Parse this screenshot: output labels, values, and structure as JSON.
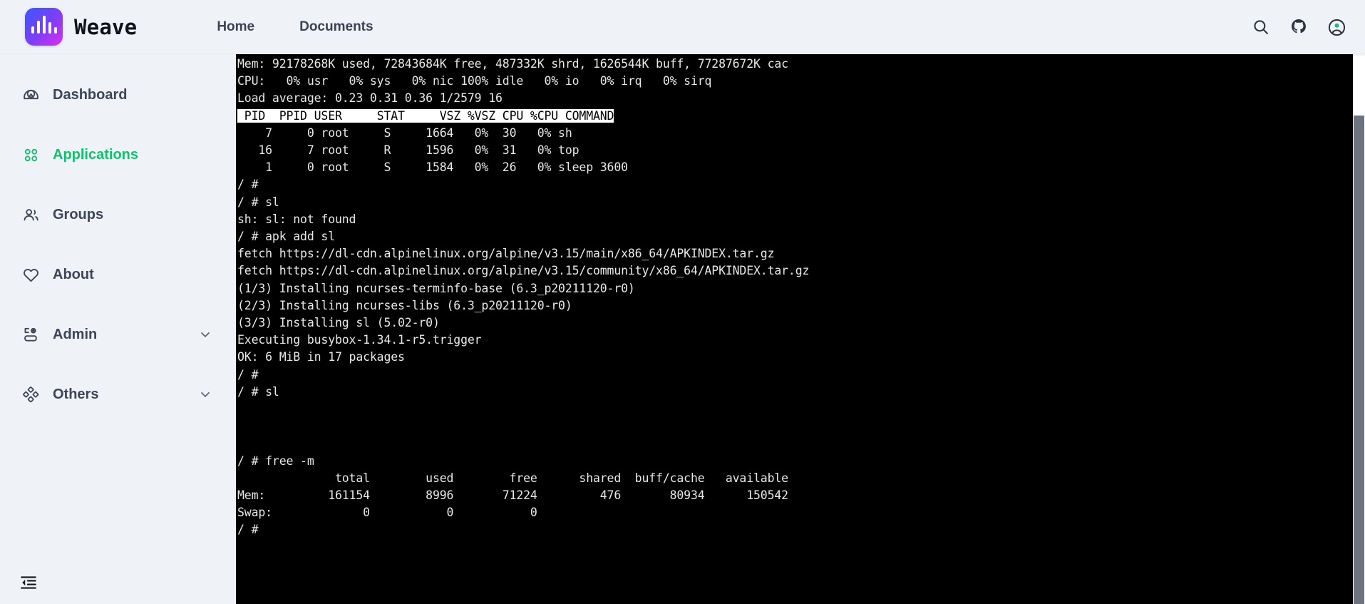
{
  "header": {
    "brand_name": "Weave",
    "logo_icon": "waveform-logo-icon",
    "nav": [
      {
        "label": "Home",
        "name": "nav-link-home"
      },
      {
        "label": "Documents",
        "name": "nav-link-documents"
      }
    ],
    "actions": [
      {
        "name": "search-icon",
        "label": "Search"
      },
      {
        "name": "github-icon",
        "label": "GitHub"
      },
      {
        "name": "account-icon",
        "label": "Account"
      }
    ]
  },
  "sidebar": {
    "items": [
      {
        "label": "Dashboard",
        "icon": "dashboard-icon",
        "active": false,
        "expandable": false
      },
      {
        "label": "Applications",
        "icon": "applications-icon",
        "active": true,
        "expandable": false
      },
      {
        "label": "Groups",
        "icon": "groups-icon",
        "active": false,
        "expandable": false
      },
      {
        "label": "About",
        "icon": "heart-icon",
        "active": false,
        "expandable": false
      },
      {
        "label": "Admin",
        "icon": "admin-icon",
        "active": false,
        "expandable": true
      },
      {
        "label": "Others",
        "icon": "others-icon",
        "active": false,
        "expandable": true
      }
    ],
    "collapse_button_label": "Collapse sidebar"
  },
  "colors": {
    "page_background": "#eff2f7",
    "accent_green": "#16bf6f",
    "sidebar_text": "#3d4557",
    "terminal_background": "#000000",
    "terminal_text": "#e8e8e8",
    "logo_gradient_start": "#3a58fd",
    "logo_gradient_end": "#dc2ef0",
    "scrollbar_thumb": "#6e7380"
  },
  "terminal": {
    "header_row": " PID  PPID USER     STAT     VSZ %VSZ CPU %CPU COMMAND",
    "lines_before_header": [
      "Mem: 92178268K used, 72843684K free, 487332K shrd, 1626544K buff, 77287672K cac",
      "CPU:   0% usr   0% sys   0% nic 100% idle   0% io   0% irq   0% sirq",
      "Load average: 0.23 0.31 0.36 1/2579 16"
    ],
    "lines_after_header": [
      "    7     0 root     S     1664   0%  30   0% sh",
      "   16     7 root     R     1596   0%  31   0% top",
      "    1     0 root     S     1584   0%  26   0% sleep 3600",
      "/ #",
      "/ # sl",
      "sh: sl: not found",
      "/ # apk add sl",
      "fetch https://dl-cdn.alpinelinux.org/alpine/v3.15/main/x86_64/APKINDEX.tar.gz",
      "fetch https://dl-cdn.alpinelinux.org/alpine/v3.15/community/x86_64/APKINDEX.tar.gz",
      "(1/3) Installing ncurses-terminfo-base (6.3_p20211120-r0)",
      "(2/3) Installing ncurses-libs (6.3_p20211120-r0)",
      "(3/3) Installing sl (5.02-r0)",
      "Executing busybox-1.34.1-r5.trigger",
      "OK: 6 MiB in 17 packages",
      "/ #",
      "/ # sl",
      "",
      "",
      "",
      "/ # free -m",
      "              total        used        free      shared  buff/cache   available",
      "Mem:         161154        8996       71224         476       80934      150542",
      "Swap:             0           0           0",
      "/ #"
    ]
  }
}
